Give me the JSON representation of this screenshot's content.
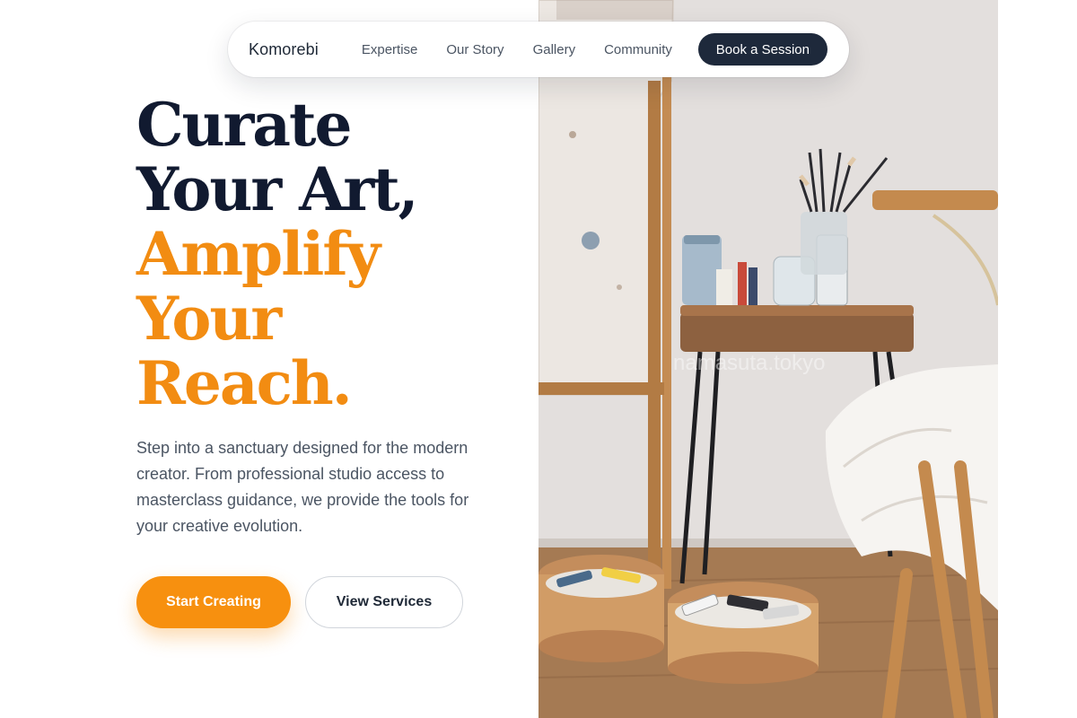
{
  "nav": {
    "brand": "Komorebi",
    "links": [
      {
        "label": "Expertise"
      },
      {
        "label": "Our Story"
      },
      {
        "label": "Gallery"
      },
      {
        "label": "Community"
      }
    ],
    "cta_label": "Book a Session"
  },
  "hero": {
    "headline_lines": [
      "Curate",
      "Your Art,",
      "Amplify",
      "Your",
      "Reach."
    ],
    "subcopy": "Step into a sanctuary designed for the modern creator. From professional studio access to masterclass guidance, we provide the tools for your creative evolution.",
    "primary_button": "Start Creating",
    "secondary_button": "View Services"
  },
  "photo": {
    "alt": "Artist studio with paint brushes, jars and tubes of paint on a wooden side table",
    "watermark": "namasuta.tokyo"
  },
  "colors": {
    "accent": "#f7900f",
    "headline_dark": "#111a30",
    "nav_button": "#1e293b"
  }
}
